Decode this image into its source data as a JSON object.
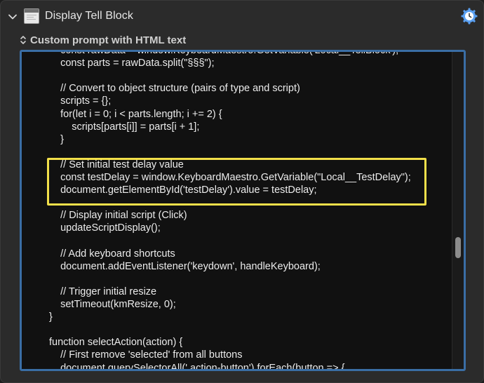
{
  "window": {
    "title": "Display Tell Block"
  },
  "prompt": {
    "label": "Custom prompt with HTML text"
  },
  "icons": {
    "disclosure": "chevron-down-icon",
    "app": "window-icon",
    "gear": "gear-clock-icon",
    "sort": "up-down-arrows-icon"
  },
  "colors": {
    "focus_border": "#3a6ea5",
    "highlight_border": "#f2e04a",
    "gear_accent": "#5aa0f2"
  },
  "code": {
    "lines": [
      "    const rawData = window.KeyboardMaestro.GetVariable('Local__TellBlock');",
      "    const parts = rawData.split(\"§§§\");",
      "",
      "    // Convert to object structure (pairs of type and script)",
      "    scripts = {};",
      "    for(let i = 0; i < parts.length; i += 2) {",
      "        scripts[parts[i]] = parts[i + 1];",
      "    }",
      "",
      "    // Set initial test delay value",
      "    const testDelay = window.KeyboardMaestro.GetVariable(\"Local__TestDelay\");",
      "    document.getElementById('testDelay').value = testDelay;",
      "",
      "    // Display initial script (Click)",
      "    updateScriptDisplay();",
      "",
      "    // Add keyboard shortcuts",
      "    document.addEventListener('keydown', handleKeyboard);",
      "",
      "    // Trigger initial resize",
      "    setTimeout(kmResize, 0);",
      "}",
      "",
      "function selectAction(action) {",
      "    // First remove 'selected' from all buttons",
      "    document.querySelectorAll('.action-button').forEach(button => {"
    ]
  }
}
